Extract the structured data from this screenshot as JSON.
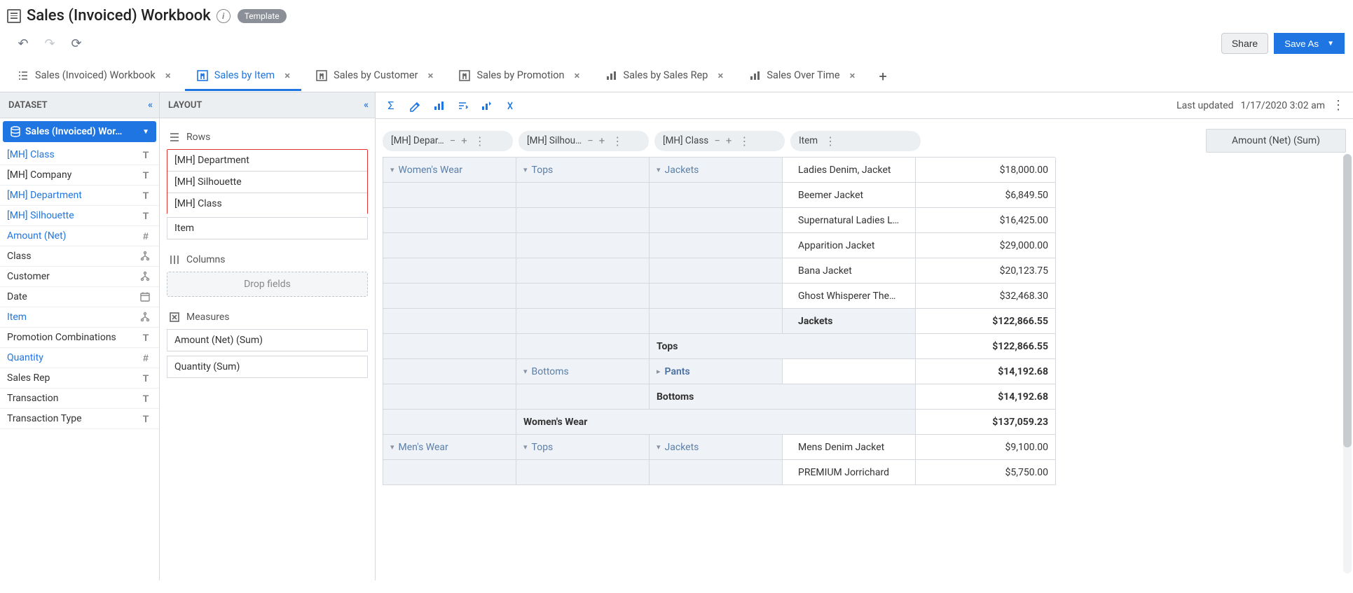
{
  "header": {
    "title": "Sales (Invoiced) Workbook",
    "template_badge": "Template"
  },
  "actions": {
    "share": "Share",
    "save_as": "Save As"
  },
  "tabs": [
    {
      "label": "Sales (Invoiced) Workbook",
      "icon": "list",
      "active": false
    },
    {
      "label": "Sales by Item",
      "icon": "pivot",
      "active": true
    },
    {
      "label": "Sales by Customer",
      "icon": "pivot",
      "active": false
    },
    {
      "label": "Sales by Promotion",
      "icon": "pivot",
      "active": false
    },
    {
      "label": "Sales by Sales Rep",
      "icon": "chart",
      "active": false
    },
    {
      "label": "Sales Over Time",
      "icon": "chart",
      "active": false
    }
  ],
  "dataset": {
    "panel_title": "DATASET",
    "selected": "Sales (Invoiced) Wor…",
    "fields": [
      {
        "name": "[MH] Class",
        "type": "T",
        "link": true
      },
      {
        "name": "[MH] Company",
        "type": "T",
        "link": false
      },
      {
        "name": "[MH] Department",
        "type": "T",
        "link": true
      },
      {
        "name": "[MH] Silhouette",
        "type": "T",
        "link": true
      },
      {
        "name": "Amount (Net)",
        "type": "#",
        "link": true
      },
      {
        "name": "Class",
        "type": "hier",
        "link": false
      },
      {
        "name": "Customer",
        "type": "hier",
        "link": false
      },
      {
        "name": "Date",
        "type": "date",
        "link": false
      },
      {
        "name": "Item",
        "type": "hier",
        "link": true
      },
      {
        "name": "Promotion Combinations",
        "type": "T",
        "link": false
      },
      {
        "name": "Quantity",
        "type": "#",
        "link": true
      },
      {
        "name": "Sales Rep",
        "type": "T",
        "link": false
      },
      {
        "name": "Transaction",
        "type": "T",
        "link": false
      },
      {
        "name": "Transaction Type",
        "type": "T",
        "link": false
      }
    ]
  },
  "layout": {
    "panel_title": "LAYOUT",
    "rows_title": "Rows",
    "columns_title": "Columns",
    "measures_title": "Measures",
    "row_fields": [
      "[MH] Department",
      "[MH] Silhouette",
      "[MH] Class"
    ],
    "row_field_extra": "Item",
    "columns_placeholder": "Drop fields",
    "measures": [
      "Amount (Net) (Sum)",
      "Quantity (Sum)"
    ]
  },
  "content_toolbar": {
    "last_updated_label": "Last updated",
    "last_updated_value": "1/17/2020 3:02 am"
  },
  "pivot": {
    "headers": {
      "dep": "[MH] Depar…",
      "sil": "[MH] Silhou…",
      "cls": "[MH] Class",
      "item": "Item",
      "amount": "Amount (Net) (Sum)"
    },
    "rows": [
      {
        "dep": "Women's Wear",
        "sil": "Tops",
        "cls": "Jackets",
        "item": "Ladies Denim, Jacket",
        "amount": "$18,000.00"
      },
      {
        "item": "Beemer Jacket",
        "amount": "$6,849.50"
      },
      {
        "item": "Supernatural Ladies L…",
        "amount": "$16,425.00"
      },
      {
        "item": "Apparition Jacket",
        "amount": "$29,000.00"
      },
      {
        "item": "Bana Jacket",
        "amount": "$20,123.75"
      },
      {
        "item": "Ghost Whisperer The…",
        "amount": "$32,468.30"
      },
      {
        "subtotal_cls": "Jackets",
        "amount": "$122,866.55"
      },
      {
        "subtotal_sil": "Tops",
        "amount": "$122,866.55"
      },
      {
        "sil": "Bottoms",
        "cls": "Pants",
        "cls_collapsed": true,
        "amount": "$14,192.68"
      },
      {
        "subtotal_sil": "Bottoms",
        "amount": "$14,192.68"
      },
      {
        "subtotal_dep": "Women's Wear",
        "amount": "$137,059.23"
      },
      {
        "dep": "Men's Wear",
        "sil": "Tops",
        "cls": "Jackets",
        "item": "Mens Denim Jacket",
        "amount": "$9,100.00"
      },
      {
        "item": "PREMIUM Jorrichard",
        "amount": "$5,750.00"
      }
    ]
  }
}
